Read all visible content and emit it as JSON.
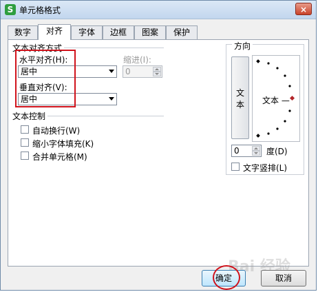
{
  "window": {
    "title": "单元格格式",
    "app_icon_glyph": "S",
    "close_glyph": "×"
  },
  "tabs": [
    {
      "label": "数字",
      "active": false
    },
    {
      "label": "对齐",
      "active": true
    },
    {
      "label": "字体",
      "active": false
    },
    {
      "label": "边框",
      "active": false
    },
    {
      "label": "图案",
      "active": false
    },
    {
      "label": "保护",
      "active": false
    }
  ],
  "alignment": {
    "group_label": "文本对齐方式",
    "horizontal_label": "水平对齐(H):",
    "horizontal_value": "居中",
    "indent_label": "缩进(I):",
    "indent_value": "0",
    "vertical_label": "垂直对齐(V):",
    "vertical_value": "居中"
  },
  "text_control": {
    "group_label": "文本控制",
    "items": [
      {
        "label": "自动换行(W)",
        "checked": false
      },
      {
        "label": "缩小字体填充(K)",
        "checked": false
      },
      {
        "label": "合并单元格(M)",
        "checked": false
      }
    ]
  },
  "orientation": {
    "group_label": "方向",
    "vertical_text_button": "文本",
    "dial_text": "文本 —",
    "degrees_value": "0",
    "degrees_label": "度(D)",
    "vertical_checkbox_label": "文字竖排(L)",
    "vertical_checkbox_checked": false
  },
  "buttons": {
    "ok": "确定",
    "cancel": "取消"
  },
  "colors": {
    "highlight_red": "#d0121b",
    "dial_pointer": "#b3262a"
  }
}
